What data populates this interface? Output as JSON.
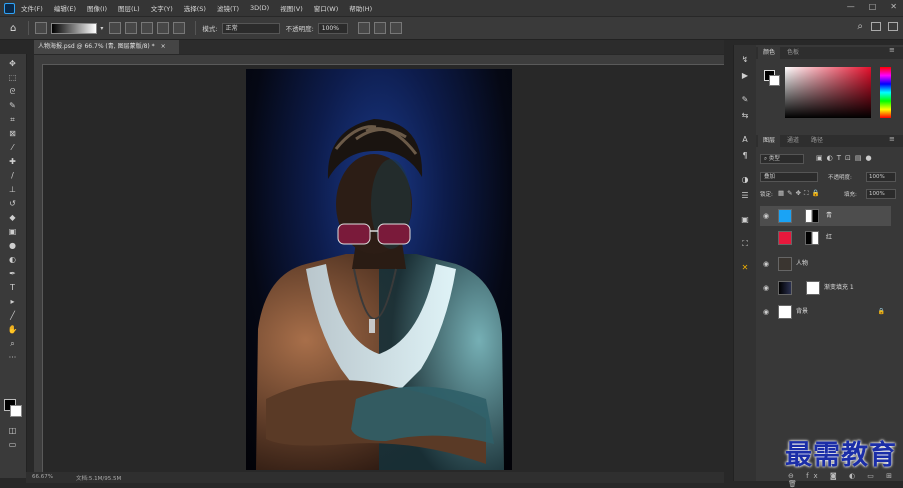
{
  "menubar": {
    "items": [
      "文件(F)",
      "编辑(E)",
      "图像(I)",
      "图层(L)",
      "文字(Y)",
      "选择(S)",
      "滤镜(T)",
      "3D(D)",
      "视图(V)",
      "窗口(W)",
      "帮助(H)"
    ],
    "window_controls": [
      "—",
      "□",
      "✕"
    ]
  },
  "options": {
    "mode_label": "模式:",
    "mode_value": "正常",
    "opacity_label": "不透明度:",
    "opacity_value": "100%"
  },
  "document": {
    "tab_title": "人物海报.psd @ 66.7% (青, 图层蒙版/8) *",
    "tab_close": "×",
    "status_zoom": "66.67%",
    "status_doc": "文档:5.1M/95.5M"
  },
  "panels": {
    "color_tabs": [
      "颜色",
      "色板"
    ],
    "layer_tabs": [
      "图层",
      "通道",
      "路径"
    ],
    "kind_label": "类型",
    "blend_mode": "叠加",
    "opacity_label": "不透明度:",
    "opacity_value": "100%",
    "lock_label": "锁定:",
    "fill_label": "填充:",
    "fill_value": "100%"
  },
  "layers": [
    {
      "name": "青",
      "thumb_color": "#1aa3f5",
      "selected": true
    },
    {
      "name": "红",
      "thumb_color": "#e8183c",
      "selected": false
    },
    {
      "name": "人物",
      "thumb_color": "#3a3530",
      "selected": false
    },
    {
      "name": "渐变填充 1",
      "thumb_color": "#000000",
      "selected": false
    },
    {
      "name": "背景",
      "thumb_color": "#ffffff",
      "selected": false
    }
  ],
  "watermark": "最需教育",
  "colors": {
    "accent": "#2fa3f7",
    "picker_hue": "#e4102c"
  }
}
